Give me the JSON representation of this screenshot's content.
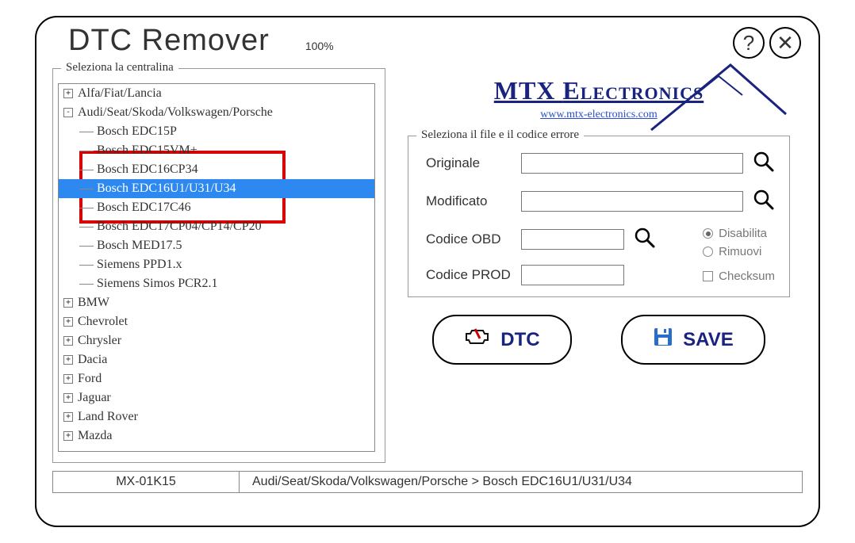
{
  "app": {
    "title": "DTC Remover",
    "progress": "100%"
  },
  "top_buttons": {
    "help": "?",
    "close": "✕"
  },
  "left": {
    "fieldset_label": "Seleziona la centralina",
    "tree": {
      "root_nodes": [
        {
          "label": "Alfa/Fiat/Lancia",
          "state": "+"
        },
        {
          "label": "Audi/Seat/Skoda/Volkswagen/Porsche",
          "state": "-"
        },
        {
          "label": "BMW",
          "state": "+"
        },
        {
          "label": "Chevrolet",
          "state": "+"
        },
        {
          "label": "Chrysler",
          "state": "+"
        },
        {
          "label": "Dacia",
          "state": "+"
        },
        {
          "label": "Ford",
          "state": "+"
        },
        {
          "label": "Jaguar",
          "state": "+"
        },
        {
          "label": "Land Rover",
          "state": "+"
        },
        {
          "label": "Mazda",
          "state": "+"
        }
      ],
      "children": [
        {
          "label": "Bosch EDC15P",
          "selected": false
        },
        {
          "label": "Bosch EDC15VM+",
          "selected": false
        },
        {
          "label": "Bosch EDC16CP34",
          "selected": false,
          "highlighted": true
        },
        {
          "label": "Bosch EDC16U1/U31/U34",
          "selected": true,
          "highlighted": true
        },
        {
          "label": "Bosch EDC17C46",
          "selected": false,
          "highlighted": true
        },
        {
          "label": "Bosch EDC17CP04/CP14/CP20",
          "selected": false
        },
        {
          "label": "Bosch MED17.5",
          "selected": false
        },
        {
          "label": "Siemens PPD1.x",
          "selected": false
        },
        {
          "label": "Siemens Simos PCR2.1",
          "selected": false
        }
      ]
    }
  },
  "brand": {
    "name_pre": "MTX ",
    "name_post": "Electronics",
    "url": "www.mtx-electronics.com"
  },
  "right": {
    "fieldset_label": "Seleziona il file e il codice errore",
    "labels": {
      "originale": "Originale",
      "modificato": "Modificato",
      "codice_obd": "Codice OBD",
      "codice_prod": "Codice PROD"
    },
    "radios": {
      "disabilita": "Disabilita",
      "rimuovi": "Rimuovi",
      "checksum": "Checksum"
    }
  },
  "actions": {
    "dtc": "DTC",
    "save": "SAVE"
  },
  "status": {
    "model": "MX-01K15",
    "path": "Audi/Seat/Skoda/Volkswagen/Porsche > Bosch EDC16U1/U31/U34"
  }
}
